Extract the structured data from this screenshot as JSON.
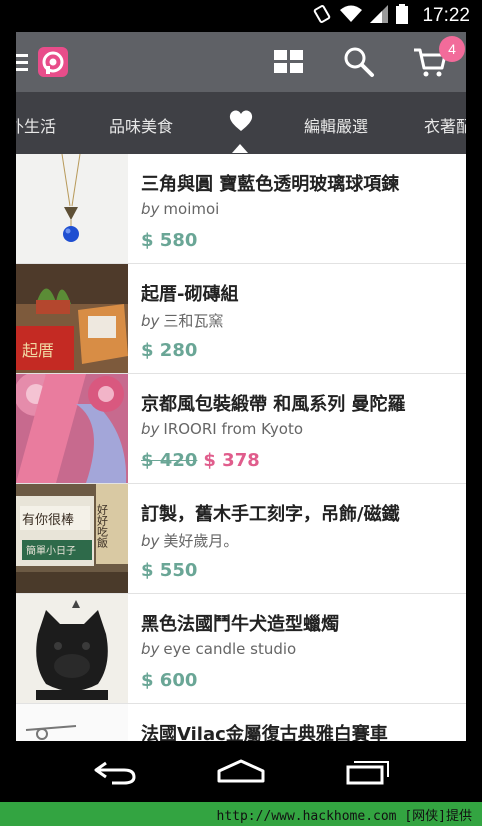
{
  "status_bar": {
    "time": "17:22"
  },
  "action_bar": {
    "cart_count": "4"
  },
  "tabs": [
    {
      "label": "外生活"
    },
    {
      "label": "品味美食"
    },
    {
      "label": "編輯嚴選"
    },
    {
      "label": "衣著配"
    }
  ],
  "items": [
    {
      "title": "三角與圓 寶藍色透明玻璃球項鍊",
      "by_prefix": "by",
      "seller": "moimoi",
      "price": "$ 580"
    },
    {
      "title": "起厝-砌磚組",
      "by_prefix": "by",
      "seller": "三和瓦窯",
      "price": "$ 280"
    },
    {
      "title": "京都風包裝緞帶 和風系列 曼陀羅",
      "by_prefix": "by",
      "seller": "IROORI from Kyoto",
      "price_old": "$ 420",
      "price_sale": "$ 378"
    },
    {
      "title": "訂製，舊木手工刻字，吊飾/磁鐵",
      "by_prefix": "by",
      "seller": "美好歲月。",
      "price": "$ 550"
    },
    {
      "title": "黑色法國鬥牛犬造型蠟燭",
      "by_prefix": "by",
      "seller": "eye candle studio",
      "price": "$ 600"
    },
    {
      "title": "法國Vilac金屬復古典雅白賽車"
    }
  ],
  "thumb_texts": {
    "brick_box": "起厝",
    "wood_sign_1": "有你很棒",
    "wood_sign_2": "簡單小日子",
    "wood_sign_3": "好好吃飯"
  },
  "watermark": {
    "text": "http://www.hackhome.com [网侠]提供"
  },
  "colors": {
    "accent": "#e84d8a",
    "price": "#6aa696",
    "sale": "#e05d8c",
    "action_bar": "#5f6166",
    "tabs": "#3f4045"
  }
}
